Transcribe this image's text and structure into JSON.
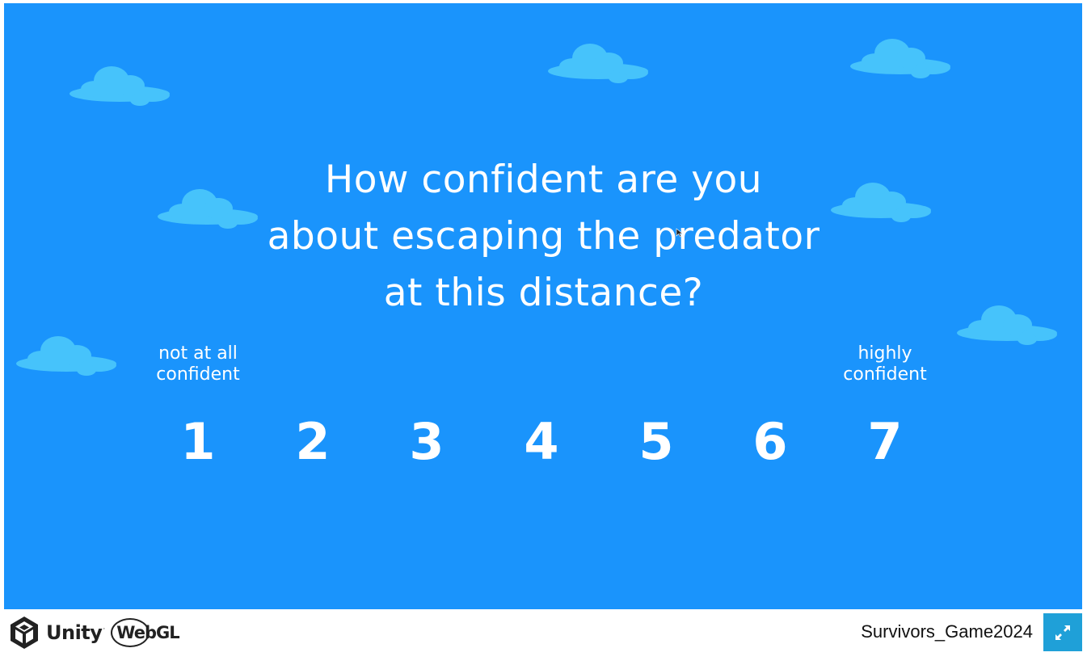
{
  "game": {
    "question_lines": [
      "How confident are you",
      "about escaping the predator",
      "at this distance?"
    ],
    "low_anchor_lines": [
      "not at all",
      "confident"
    ],
    "high_anchor_lines": [
      "highly",
      "confident"
    ],
    "scale": [
      "1",
      "2",
      "3",
      "4",
      "5",
      "6",
      "7"
    ],
    "background_color": "#1a94fc",
    "cloud_color": "#46c3fb"
  },
  "footer": {
    "unity_label": "Unity",
    "webgl_label": "WebGL",
    "build_title": "Survivors_Game2024",
    "fullscreen_icon": "fullscreen-icon",
    "fullscreen_color": "#1fa0d8"
  }
}
